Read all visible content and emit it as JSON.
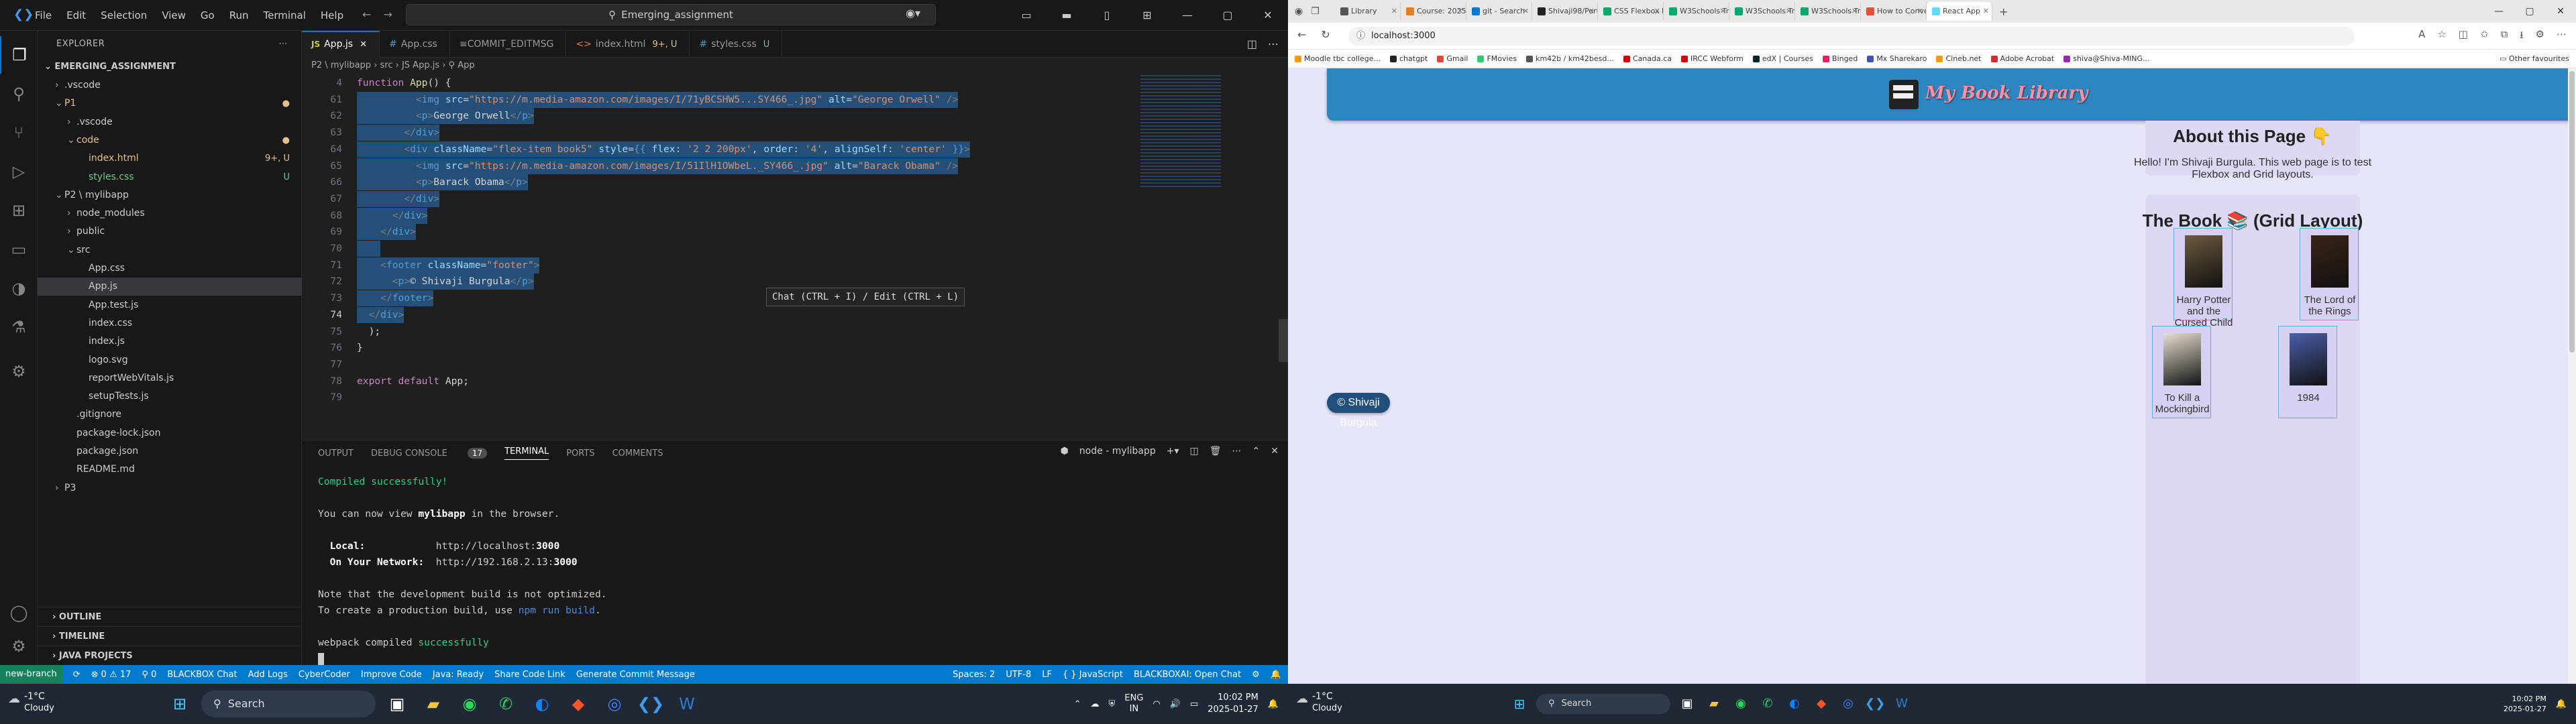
{
  "vscode": {
    "menu": [
      "File",
      "Edit",
      "Selection",
      "View",
      "Go",
      "Run",
      "Terminal",
      "Help"
    ],
    "command_center": "Emerging_assignment",
    "explorer_title": "EXPLORER",
    "root_folder": "EMERGING_ASSIGNMENT",
    "tree": [
      {
        "label": ".vscode",
        "tw": "›",
        "indent": 1,
        "cls": ""
      },
      {
        "label": "P1",
        "tw": "⌄",
        "indent": 1,
        "cls": "mod",
        "badge": "●"
      },
      {
        "label": ".vscode",
        "tw": "›",
        "indent": 2,
        "cls": ""
      },
      {
        "label": "code",
        "tw": "⌄",
        "indent": 2,
        "cls": "mod",
        "badge": "●"
      },
      {
        "label": "index.html",
        "tw": "",
        "indent": 3,
        "cls": "mod",
        "badge": "9+, U"
      },
      {
        "label": "styles.css",
        "tw": "",
        "indent": 3,
        "cls": "unt",
        "badge": "U"
      },
      {
        "label": "P2 \\ mylibapp",
        "tw": "⌄",
        "indent": 1,
        "cls": ""
      },
      {
        "label": "node_modules",
        "tw": "›",
        "indent": 2,
        "cls": ""
      },
      {
        "label": "public",
        "tw": "›",
        "indent": 2,
        "cls": ""
      },
      {
        "label": "src",
        "tw": "⌄",
        "indent": 2,
        "cls": ""
      },
      {
        "label": "App.css",
        "tw": "",
        "indent": 3,
        "cls": ""
      },
      {
        "label": "App.js",
        "tw": "",
        "indent": 3,
        "cls": "sel"
      },
      {
        "label": "App.test.js",
        "tw": "",
        "indent": 3,
        "cls": ""
      },
      {
        "label": "index.css",
        "tw": "",
        "indent": 3,
        "cls": ""
      },
      {
        "label": "index.js",
        "tw": "",
        "indent": 3,
        "cls": ""
      },
      {
        "label": "logo.svg",
        "tw": "",
        "indent": 3,
        "cls": ""
      },
      {
        "label": "reportWebVitals.js",
        "tw": "",
        "indent": 3,
        "cls": ""
      },
      {
        "label": "setupTests.js",
        "tw": "",
        "indent": 3,
        "cls": ""
      },
      {
        "label": ".gitignore",
        "tw": "",
        "indent": 2,
        "cls": ""
      },
      {
        "label": "package-lock.json",
        "tw": "",
        "indent": 2,
        "cls": ""
      },
      {
        "label": "package.json",
        "tw": "",
        "indent": 2,
        "cls": ""
      },
      {
        "label": "README.md",
        "tw": "",
        "indent": 2,
        "cls": ""
      },
      {
        "label": "P3",
        "tw": "›",
        "indent": 1,
        "cls": ""
      }
    ],
    "sections": [
      "OUTLINE",
      "TIMELINE",
      "JAVA PROJECTS"
    ],
    "tabs": [
      {
        "icon": "JS",
        "icon_cls": "js",
        "label": "App.js",
        "status": "✕",
        "status_cls": "",
        "active": true
      },
      {
        "icon": "#",
        "icon_cls": "css",
        "label": "App.css",
        "status": "",
        "status_cls": "",
        "active": false
      },
      {
        "icon": "≡",
        "icon_cls": "",
        "label": "COMMIT_EDITMSG",
        "status": "",
        "status_cls": "",
        "active": false
      },
      {
        "icon": "<>",
        "icon_cls": "html",
        "label": "index.html",
        "status": "9+, U",
        "status_cls": "mod",
        "active": false
      },
      {
        "icon": "#",
        "icon_cls": "css",
        "label": "styles.css",
        "status": "U",
        "status_cls": "unt",
        "active": false
      }
    ],
    "breadcrumb": "P2 \\ mylibapp › src › JS App.js › ⚲ App",
    "code_lines": [
      {
        "n": "4",
        "html": "<span class='t-kw'>function</span> <span class='t-fn'>App</span><span class='t-pu'>() {</span>",
        "hl": false
      },
      {
        "n": "61",
        "html": "          <span class='t-br'>&lt;</span><span class='t-tag'>img</span> <span class='t-at'>src</span>=<span class='t-st'>\"https://m.media-amazon.com/images/I/71yBCSHW5...SY466_.jpg\"</span> <span class='t-at'>alt</span>=<span class='t-st'>\"George Orwell\"</span> <span class='t-br'>/&gt;</span>",
        "hl": true
      },
      {
        "n": "62",
        "html": "          <span class='t-br'>&lt;</span><span class='t-tag'>p</span><span class='t-br'>&gt;</span><span class='t-tx'>George Orwell</span><span class='t-br'>&lt;/</span><span class='t-tag'>p</span><span class='t-br'>&gt;</span>",
        "hl": true
      },
      {
        "n": "63",
        "html": "        <span class='t-br'>&lt;/</span><span class='t-tag'>div</span><span class='t-br'>&gt;</span>",
        "hl": true
      },
      {
        "n": "64",
        "html": "        <span class='t-br'>&lt;</span><span class='t-tag'>div</span> <span class='t-at'>className</span>=<span class='t-st'>\"flex-item book5\"</span> <span class='t-at'>style</span>=<span class='t-bl'>{{</span> <span class='t-at'>flex</span>: <span class='t-st'>'2 2 200px'</span>, <span class='t-at'>order</span>: <span class='t-st'>'4'</span>, <span class='t-at'>alignSelf</span>: <span class='t-st'>'center'</span> <span class='t-bl'>}}</span><span class='t-br'>&gt;</span>",
        "hl": true
      },
      {
        "n": "65",
        "html": "          <span class='t-br'>&lt;</span><span class='t-tag'>img</span> <span class='t-at'>src</span>=<span class='t-st'>\"https://m.media-amazon.com/images/I/51IlH1OWbeL._SY466_.jpg\"</span> <span class='t-at'>alt</span>=<span class='t-st'>\"Barack Obama\"</span> <span class='t-br'>/&gt;</span>",
        "hl": true
      },
      {
        "n": "66",
        "html": "          <span class='t-br'>&lt;</span><span class='t-tag'>p</span><span class='t-br'>&gt;</span><span class='t-tx'>Barack Obama</span><span class='t-br'>&lt;/</span><span class='t-tag'>p</span><span class='t-br'>&gt;</span>",
        "hl": true
      },
      {
        "n": "67",
        "html": "        <span class='t-br'>&lt;/</span><span class='t-tag'>div</span><span class='t-br'>&gt;</span>",
        "hl": true
      },
      {
        "n": "68",
        "html": "      <span class='t-br'>&lt;/</span><span class='t-tag'>div</span><span class='t-br'>&gt;</span>",
        "hl": true
      },
      {
        "n": "69",
        "html": "    <span class='t-br'>&lt;/</span><span class='t-tag'>div</span><span class='t-br'>&gt;</span>",
        "hl": true
      },
      {
        "n": "70",
        "html": "    ",
        "hl": true
      },
      {
        "n": "71",
        "html": "    <span class='t-br'>&lt;</span><span class='t-tag'>footer</span> <span class='t-at'>className</span>=<span class='t-st'>\"footer\"</span><span class='t-br'>&gt;</span>",
        "hl": true
      },
      {
        "n": "72",
        "html": "      <span class='t-br'>&lt;</span><span class='t-tag'>p</span><span class='t-br'>&gt;</span><span class='t-tx'>© Shivaji Burgula</span><span class='t-br'>&lt;/</span><span class='t-tag'>p</span><span class='t-br'>&gt;</span>",
        "hl": true
      },
      {
        "n": "73",
        "html": "    <span class='t-br'>&lt;/</span><span class='t-tag'>footer</span><span class='t-br'>&gt;</span>",
        "hl": true
      },
      {
        "n": "74",
        "html": "  <span class='t-br'>&lt;/</span><span class='t-tag'>div</span><span class='t-br'>&gt;</span>",
        "hl": true
      },
      {
        "n": "75",
        "html": "  <span class='t-pu'>);</span>",
        "hl": false
      },
      {
        "n": "76",
        "html": "<span class='t-pu'>}</span>",
        "hl": false
      },
      {
        "n": "77",
        "html": "",
        "hl": false
      },
      {
        "n": "78",
        "html": "<span class='t-kw'>export</span> <span class='t-kw'>default</span> <span class='t-tx'>App</span><span class='t-pu'>;</span>",
        "hl": false
      },
      {
        "n": "79",
        "html": "",
        "hl": false
      }
    ],
    "hint": "Chat (CTRL + I) / Edit (CTRL + L)",
    "panel_tabs": [
      "OUTPUT",
      "DEBUG CONSOLE",
      "TERMINAL",
      "PORTS",
      "COMMENTS"
    ],
    "problems_count": "17",
    "terminal_name": "node - mylibapp",
    "terminal": {
      "compiled": "Compiled successfully!",
      "view_pre": "You can now view ",
      "app": "mylibapp",
      "view_post": " in the browser.",
      "local_label": "  Local:",
      "local_url_pre": "            http://localhost:",
      "local_port": "3000",
      "net_label": "  On Your Network:",
      "net_url_pre": "  http://192.168.2.13:",
      "net_port": "3000",
      "note1": "Note that the development build is not optimized.",
      "note2_pre": "To create a production build, use ",
      "note2_cmd": "npm run build",
      "note2_post": ".",
      "webpack_pre": "webpack compiled ",
      "webpack_ok": "successfully"
    },
    "status_left": [
      "new-branch",
      "⟳",
      "⊗ 0 ⚠ 17",
      "⚲ 0",
      "BLACKBOX Chat",
      "Add Logs",
      "CyberCoder",
      "Improve Code",
      "Java: Ready",
      "Share Code Link",
      "Generate Commit Message"
    ],
    "status_right": [
      "Spaces: 2",
      "UTF-8",
      "LF",
      "{ } JavaScript",
      "BLACKBOXAI: Open Chat",
      "⚙",
      "🔔"
    ]
  },
  "taskbar_left": {
    "temp": "-1°C",
    "cond": "Cloudy",
    "search": "Search",
    "lang1": "ENG",
    "lang2": "IN",
    "time": "10:02 PM",
    "date": "2025-01-27"
  },
  "browser": {
    "tabs": [
      {
        "label": "Library",
        "color": "#555"
      },
      {
        "label": "Course: 2025W-T...",
        "color": "#e67e22"
      },
      {
        "label": "git - Search",
        "color": "#0078d4"
      },
      {
        "label": "Shivaji98/Portfoli...",
        "color": "#222"
      },
      {
        "label": "CSS Flexbox Items",
        "color": "#04aa6d"
      },
      {
        "label": "W3Schools Tryit E...",
        "color": "#04aa6d"
      },
      {
        "label": "W3Schools Tryit E...",
        "color": "#04aa6d"
      },
      {
        "label": "W3Schools Tryit E...",
        "color": "#04aa6d"
      },
      {
        "label": "How to Convert H...",
        "color": "#e74c3c"
      },
      {
        "label": "React App",
        "color": "#61dafb"
      }
    ],
    "url": "localhost:3000",
    "bookmarks": [
      {
        "label": "Moodle tbc college...",
        "color": "#f39c12"
      },
      {
        "label": "chatgpt",
        "color": "#222"
      },
      {
        "label": "Gmail",
        "color": "#ea4335"
      },
      {
        "label": "FMovies",
        "color": "#2ecc71"
      },
      {
        "label": "km42b / km42besd...",
        "color": "#555"
      },
      {
        "label": "Canada.ca",
        "color": "#d50000"
      },
      {
        "label": "IRCC Webform",
        "color": "#d50000"
      },
      {
        "label": "edX | Courses",
        "color": "#02262b"
      },
      {
        "label": "Binged",
        "color": "#e91e63"
      },
      {
        "label": "Mx Sharekaro",
        "color": "#3f51b5"
      },
      {
        "label": "Cineb.net",
        "color": "#ff9800"
      },
      {
        "label": "Adobe Acrobat",
        "color": "#d32f2f"
      },
      {
        "label": "shiva@Shiva-MING...",
        "color": "#9c27b0"
      }
    ],
    "other_favourites": "Other favourites",
    "page": {
      "site_title": "My Book Library",
      "about_title": "About this Page 👇",
      "about_text": "Hello! I'm Shivaji Burgula. This web page is to test Flexbox and Grid layouts.",
      "books_title": "The Book 📚 (Grid Layout)",
      "books": [
        {
          "title": "Harry Potter and the Cursed Child",
          "cover": "#6b5a3e"
        },
        {
          "title": "The Lord of the Rings",
          "cover": "#3a2418"
        },
        {
          "title": "To Kill a Mockingbird",
          "cover": "#e8e0d0"
        },
        {
          "title": "1984",
          "cover": "#4a5fa8"
        }
      ],
      "footer": "© Shivaji Burgula"
    }
  },
  "taskbar_right": {
    "temp": "-1°C",
    "cond": "Cloudy",
    "search": "Search",
    "time": "10:02 PM",
    "date": "2025-01-27"
  }
}
